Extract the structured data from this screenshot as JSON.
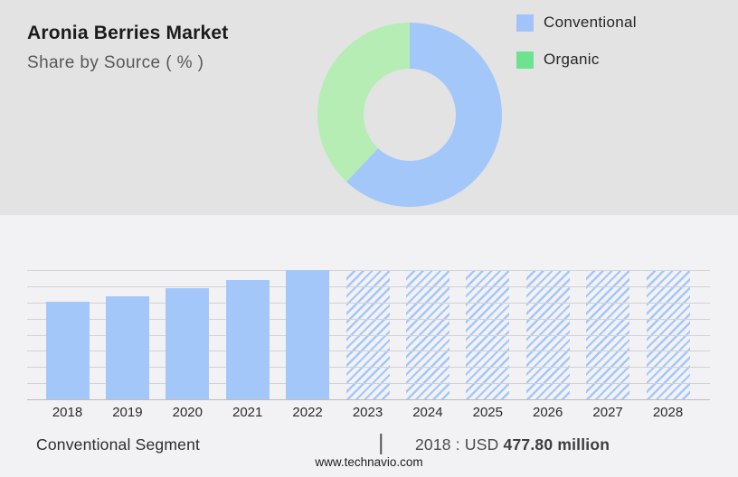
{
  "header": {
    "title": "Aronia Berries Market",
    "subtitle": "Share by Source ( % )"
  },
  "legend": {
    "items": [
      {
        "label": "Conventional",
        "color": "#a2c3fa"
      },
      {
        "label": "Organic",
        "color": "#6de28f"
      }
    ]
  },
  "chart_data": [
    {
      "type": "pie",
      "subtype": "donut",
      "title": "Share by Source ( % )",
      "labels": [
        "Conventional",
        "Organic"
      ],
      "values": [
        62,
        38
      ],
      "unit": "%",
      "values_note": "estimated from arc angles; no data labels shown in image",
      "colors": [
        "#a4c7fa",
        "#b5edb5"
      ],
      "start_angle_deg": 0,
      "direction": "clockwise",
      "legend_position": "top-right"
    },
    {
      "type": "bar",
      "categories": [
        "2018",
        "2019",
        "2020",
        "2021",
        "2022",
        "2023",
        "2024",
        "2025",
        "2026",
        "2027",
        "2028"
      ],
      "values_relative": [
        0.755,
        0.797,
        0.86,
        0.923,
        1.0,
        1.0,
        1.0,
        1.0,
        1.0,
        1.0,
        1.0
      ],
      "values_note": "no numeric y-axis shown; heights relative to top gridline; 2023-2028 are hatched forecast bars at full height",
      "solid_years": [
        "2018",
        "2019",
        "2020",
        "2021",
        "2022"
      ],
      "hatched_years": [
        "2023",
        "2024",
        "2025",
        "2026",
        "2027",
        "2028"
      ],
      "known_values": {
        "2018": "USD 477.80 million"
      },
      "bar_color": "#a4c7fa",
      "gridline_rows": 8,
      "grid_on": true,
      "xlabel": "",
      "ylabel": ""
    }
  ],
  "caption": {
    "segment_label": "Conventional Segment",
    "separator": "|",
    "value_prefix": "2018 : USD ",
    "value_bold": "477.80 million"
  },
  "footer": {
    "website": "www.technavio.com"
  },
  "colors": {
    "top_panel_bg": "#e3e3e4",
    "bottom_panel_bg": "#f2f2f4",
    "gridline": "#d2d2d4",
    "axis_line": "#bdbdbf"
  }
}
